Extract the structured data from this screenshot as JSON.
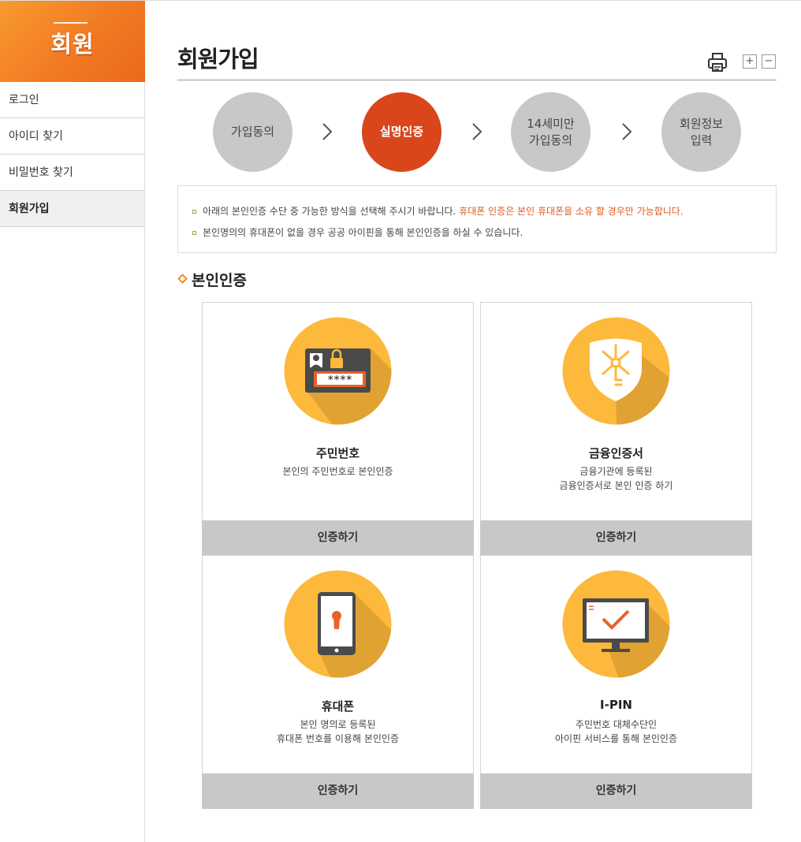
{
  "sidebar": {
    "title": "회원",
    "items": [
      {
        "label": "로그인"
      },
      {
        "label": "아이디 찾기"
      },
      {
        "label": "비밀번호 찾기"
      },
      {
        "label": "회원가입"
      }
    ]
  },
  "header": {
    "title": "회원가입",
    "zoom_in": "+",
    "zoom_out": "−"
  },
  "steps": [
    {
      "line1": "가입동의",
      "line2": ""
    },
    {
      "line1": "실명인증",
      "line2": ""
    },
    {
      "line1": "14세미만",
      "line2": "가입동의"
    },
    {
      "line1": "회원정보",
      "line2": "입력"
    }
  ],
  "notice": {
    "line1_text": "아래의 본인인증 수단 중 가능한 방식을 선택해 주시기 바랍니다. ",
    "line1_highlight": "휴대폰 인증은 본인 휴대폰을 소유 할 경우만 가능합니다.",
    "line2_text": "본인명의의 휴대폰이 없을 경우 공공 아이핀을 통해 본인인증을 하실 수 있습니다."
  },
  "section": {
    "title": "본인인증"
  },
  "cards": [
    {
      "name": "주민번호",
      "desc1": "본인의 주민번호로 본인인증",
      "desc2": "",
      "button": "인증하기",
      "icon": "id-card-lock-icon"
    },
    {
      "name": "금융인증서",
      "desc1": "금융기관에 등록된",
      "desc2": "금융인증서로 본인 인증 하기",
      "button": "인증하기",
      "icon": "shield-key-icon"
    },
    {
      "name": "휴대폰",
      "desc1": "본인 명의로 등록된",
      "desc2": "휴대폰 번호를 이용해 본인인증",
      "button": "인증하기",
      "icon": "phone-lock-icon"
    },
    {
      "name": "I-PIN",
      "desc1": "주민번호 대체수단인",
      "desc2": "아이핀 서비스를 통해 본인인증",
      "button": "인증하기",
      "icon": "monitor-check-icon"
    }
  ],
  "card_password_mask": "****",
  "colors": {
    "accent": "#d9461c",
    "brand_orange": "#f27a24",
    "icon_yellow": "#fdb93c",
    "highlight": "#e05a1c"
  }
}
